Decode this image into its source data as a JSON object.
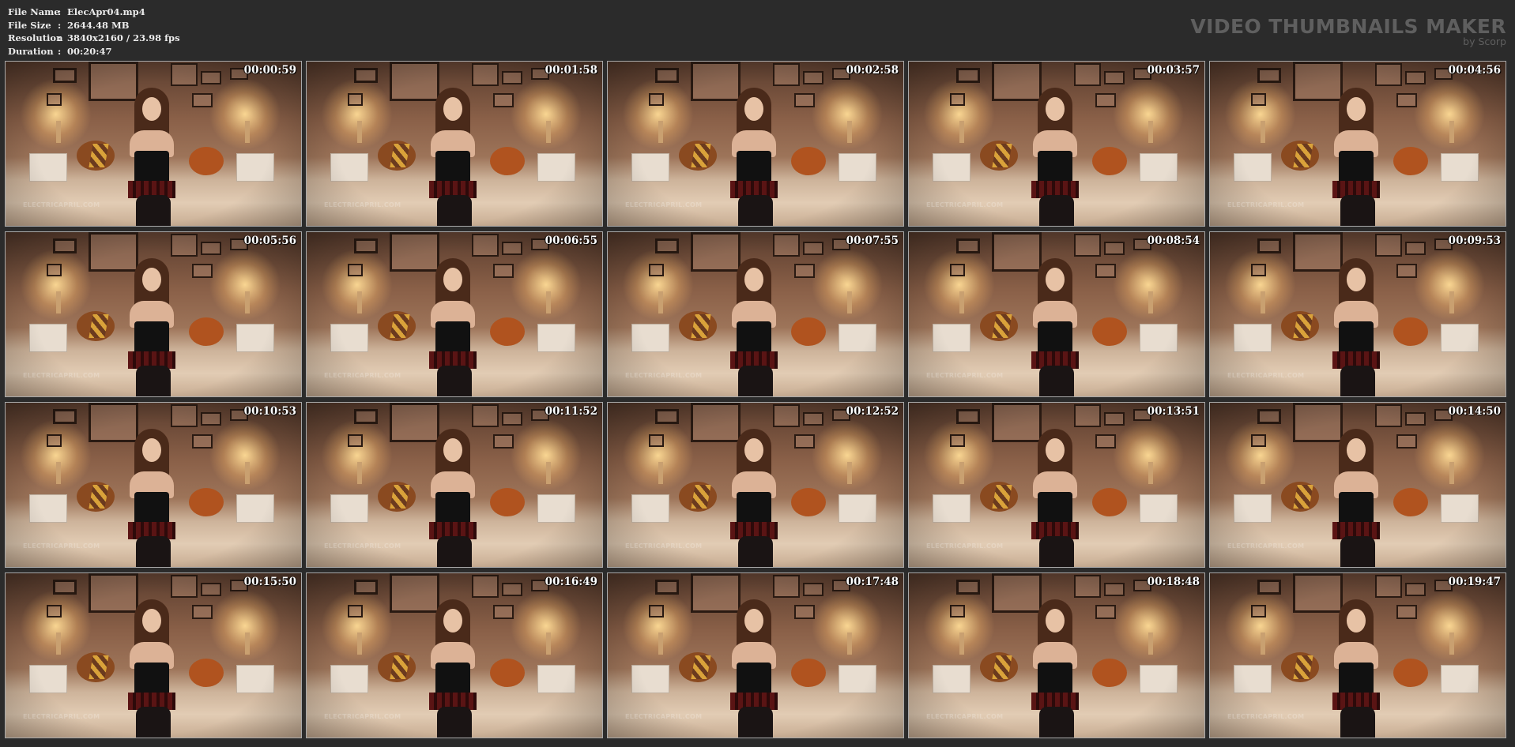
{
  "info": {
    "file_name_label": "File Name",
    "file_name": "ElecApr04.mp4",
    "file_size_label": "File Size",
    "file_size": "2644.48 MB",
    "resolution_label": "Resolution",
    "resolution": "3840x2160 / 23.98 fps",
    "duration_label": "Duration",
    "duration": "00:20:47",
    "separator": ":"
  },
  "brand": {
    "title": "VIDEO THUMBNAILS MAKER",
    "subtitle": "by Scorp"
  },
  "watermark": "ELECTRICAPRIL.COM",
  "thumbnails": [
    {
      "time": "00:00:59"
    },
    {
      "time": "00:01:58"
    },
    {
      "time": "00:02:58"
    },
    {
      "time": "00:03:57"
    },
    {
      "time": "00:04:56"
    },
    {
      "time": "00:05:56"
    },
    {
      "time": "00:06:55"
    },
    {
      "time": "00:07:55"
    },
    {
      "time": "00:08:54"
    },
    {
      "time": "00:09:53"
    },
    {
      "time": "00:10:53"
    },
    {
      "time": "00:11:52"
    },
    {
      "time": "00:12:52"
    },
    {
      "time": "00:13:51"
    },
    {
      "time": "00:14:50"
    },
    {
      "time": "00:15:50"
    },
    {
      "time": "00:16:49"
    },
    {
      "time": "00:17:48"
    },
    {
      "time": "00:18:48"
    },
    {
      "time": "00:19:47"
    }
  ]
}
